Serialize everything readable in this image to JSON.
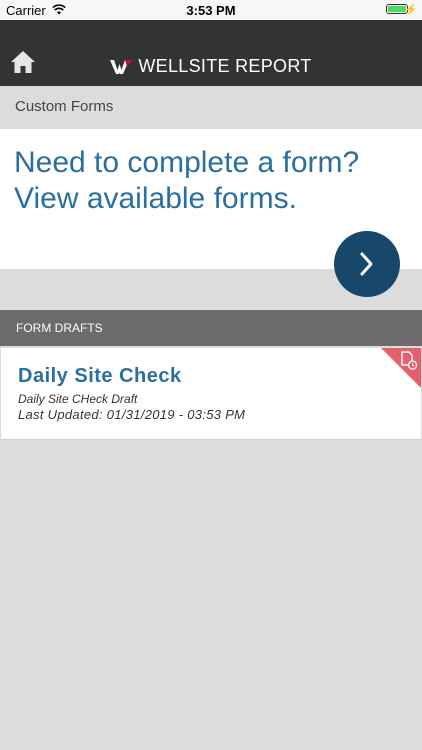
{
  "status_bar": {
    "carrier": "Carrier",
    "time": "3:53 PM",
    "charge_symbol": "⚡"
  },
  "nav": {
    "brand": "WELLSITE REPORT",
    "home_icon": "home-icon",
    "logo_icon": "wellsite-logo-icon"
  },
  "section": {
    "label": "Custom Forms"
  },
  "hero": {
    "line1": "Need to complete a form?",
    "line2": "View available forms.",
    "button_icon": "chevron-right-icon"
  },
  "drafts": {
    "header": "FORM DRAFTS",
    "items": [
      {
        "title": "Daily Site Check",
        "subtitle": "Daily Site CHeck Draft",
        "updated": "Last Updated: 01/31/2019 - 03:53 PM",
        "badge_icon": "draft-document-icon"
      }
    ]
  },
  "colors": {
    "nav_bg": "#333333",
    "accent_blue": "#2a6fa0",
    "button_blue": "#17486b",
    "drafts_header_bg": "#6b6b6b",
    "badge_red": "#e4606d",
    "page_bg": "#dcdcdc"
  }
}
